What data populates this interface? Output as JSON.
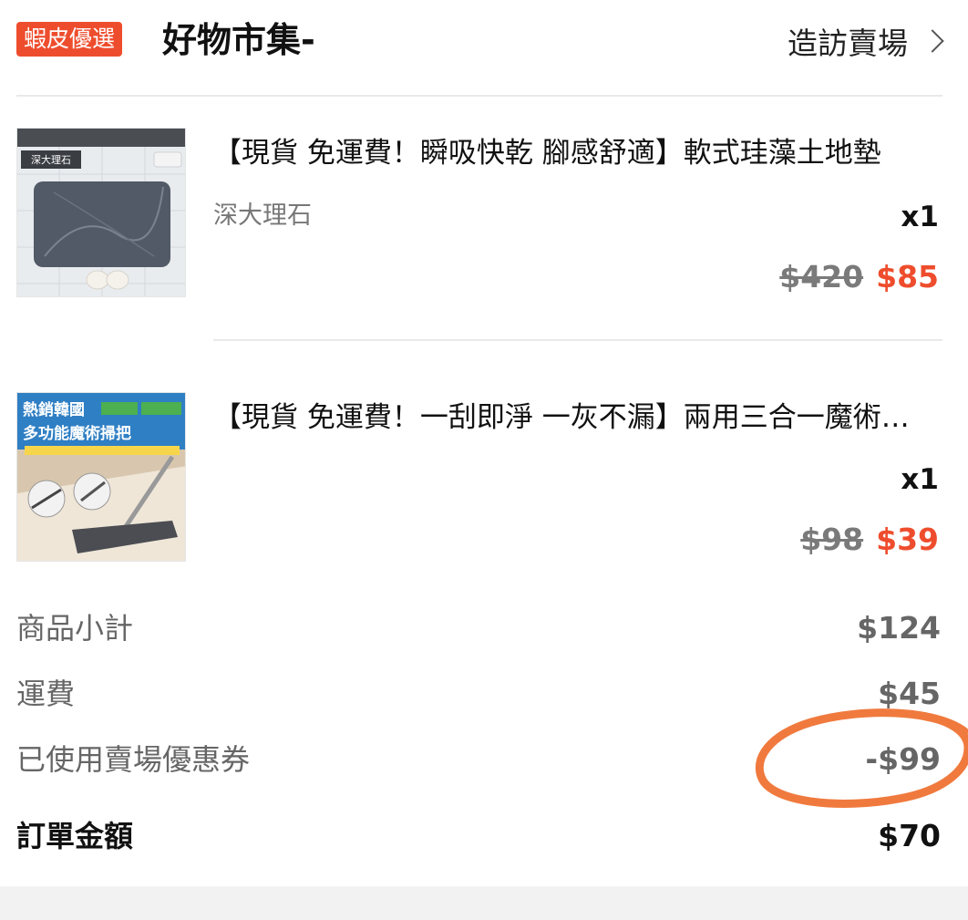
{
  "shop": {
    "badge": "蝦皮優選",
    "name": "好物市集-",
    "visit_label": "造訪賣場",
    "accent_color": "#ee4d2d"
  },
  "items": [
    {
      "title": "【現貨 免運費！瞬吸快乾 腳感舒適】軟式珪藻土地墊",
      "variant": "深大理石",
      "quantity": "x1",
      "original_price": "$420",
      "sale_price": "$85",
      "thumb_label": "深大理石",
      "thumb_icon": "marble-bath-mat-image"
    },
    {
      "title": "【現貨 免運費！一刮即淨 一灰不漏】兩用三合一魔術掃把",
      "variant": "",
      "quantity": "x1",
      "original_price": "$98",
      "sale_price": "$39",
      "thumb_label_1": "熱銷韓國",
      "thumb_label_2": "多功能魔術掃把",
      "thumb_icon": "magic-broom-image"
    }
  ],
  "summary": {
    "subtotal_label": "商品小計",
    "subtotal_value": "$124",
    "shipping_label": "運費",
    "shipping_value": "$45",
    "voucher_label": "已使用賣場優惠券",
    "voucher_value": "-$99",
    "total_label": "訂單金額",
    "total_value": "$70"
  },
  "annotation": {
    "color": "#f07a3e",
    "icon": "hand-drawn-circle"
  }
}
